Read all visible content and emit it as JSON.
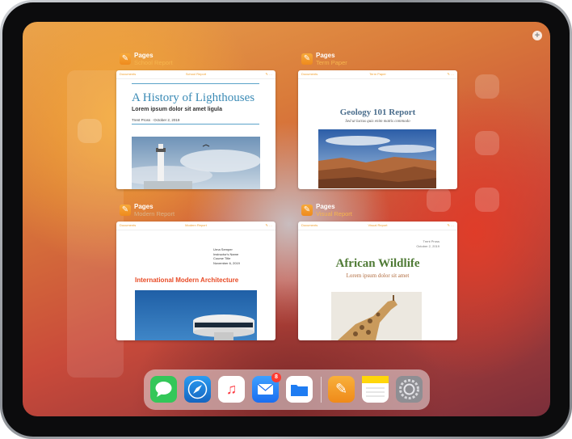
{
  "switcher": {
    "cards": [
      {
        "app": "Pages",
        "doc": "School Report",
        "toolbar": {
          "left": "Documents",
          "center": "School Report"
        },
        "title": "A History of Lighthouses",
        "subtitle": "Lorem ipsum dolor sit amet ligula",
        "byline": "Trent Pross · October 2, 2019"
      },
      {
        "app": "Pages",
        "doc": "Term Paper",
        "toolbar": {
          "left": "Documents",
          "center": "Term Paper"
        },
        "title": "Geology 101 Report",
        "subtitle": "Sed ut luctus quis enim mattis commodo"
      },
      {
        "app": "Pages",
        "doc": "Modern Report",
        "toolbar": {
          "left": "Documents",
          "center": "Modern Report"
        },
        "info": [
          "Urna Semper",
          "Instructor's Name",
          "Course Title",
          "November 6, 2019"
        ],
        "title": "International Modern Architecture"
      },
      {
        "app": "Pages",
        "doc": "Visual Report",
        "toolbar": {
          "left": "Documents",
          "center": "Visual Report"
        },
        "meta": [
          "Trent Pross",
          "October 2, 2019"
        ],
        "title": "African Wildlife",
        "subtitle": "Lorem ipsum dolor sit amet"
      }
    ]
  },
  "dock": {
    "apps": [
      {
        "name": "Messages",
        "icon": "messages-icon",
        "color": "#34c759"
      },
      {
        "name": "Safari",
        "icon": "safari-icon",
        "color": "#1e88e5"
      },
      {
        "name": "Music",
        "icon": "music-icon",
        "color": "#fc3c44"
      },
      {
        "name": "Mail",
        "icon": "mail-icon",
        "color": "#1a82fb",
        "badge": "8"
      },
      {
        "name": "Files",
        "icon": "files-icon",
        "color": "#1e7cf2"
      },
      {
        "name": "Pages",
        "icon": "pages-icon",
        "color": "#f5a623"
      },
      {
        "name": "Notes",
        "icon": "notes-icon",
        "color": "#ffd60a"
      },
      {
        "name": "Settings",
        "icon": "settings-icon",
        "color": "#8e8e93"
      }
    ]
  }
}
